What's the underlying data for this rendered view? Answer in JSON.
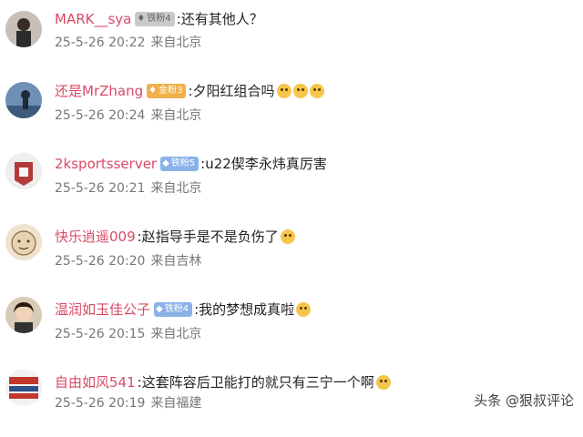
{
  "comments": [
    {
      "username": "MARK__sya",
      "badge": "铁粉4",
      "badge_style": "gray",
      "text": "还有其他人？",
      "emoji_count": 0,
      "date": "25-5-26 20:22",
      "location": "来自北京"
    },
    {
      "username": "还是MrZhang",
      "badge": "金粉3",
      "badge_style": "gold",
      "text": "夕阳红组合吗",
      "emoji_count": 3,
      "date": "25-5-26 20:24",
      "location": "来自北京"
    },
    {
      "username": "2ksportsserver",
      "badge": "铁粉5",
      "badge_style": "blue",
      "text": "u22偰李永炜真厉害",
      "emoji_count": 0,
      "date": "25-5-26 20:21",
      "location": "来自北京"
    },
    {
      "username": "快乐逍遥009",
      "badge": "",
      "badge_style": "",
      "text": "赵指导手是不是负伤了",
      "emoji_count": 1,
      "date": "25-5-26 20:20",
      "location": "来自吉林"
    },
    {
      "username": "温润如玉佳公子",
      "badge": "铁粉4",
      "badge_style": "blue",
      "text": "我的梦想成真啦",
      "emoji_count": 1,
      "date": "25-5-26 20:15",
      "location": "来自北京"
    },
    {
      "username": "自由如风541",
      "badge": "",
      "badge_style": "",
      "text": "这套阵容后卫能打的就只有三宁一个啊",
      "emoji_count": 1,
      "date": "25-5-26 20:19",
      "location": "来自福建"
    }
  ],
  "separator": ":",
  "watermark": "头条 @狠叔评论"
}
